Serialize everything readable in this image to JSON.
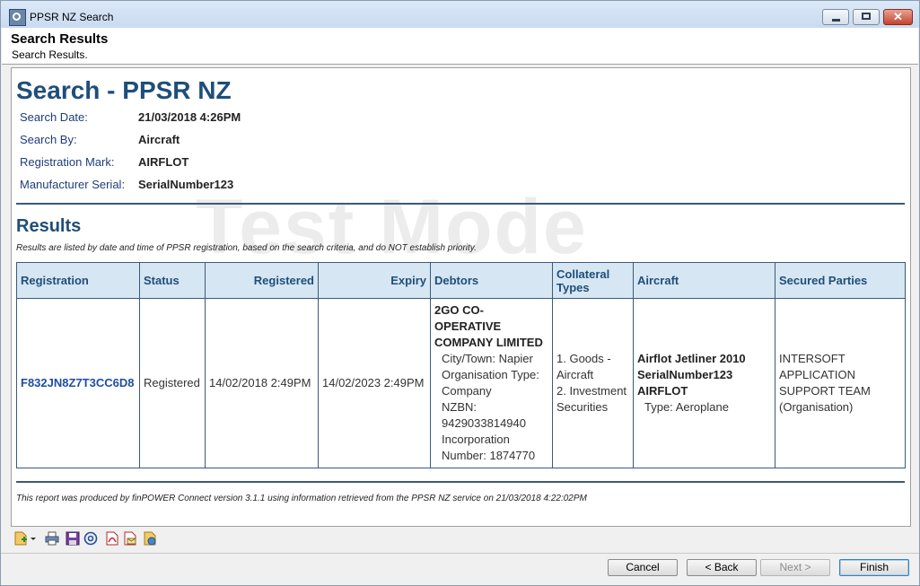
{
  "window": {
    "title": "PPSR NZ Search"
  },
  "header": {
    "title": "Search Results",
    "subtitle": "Search Results."
  },
  "report": {
    "title": "Search - PPSR NZ",
    "watermark": "Test Mode",
    "fields": [
      {
        "label": "Search Date:",
        "value": "21/03/2018 4:26PM"
      },
      {
        "label": "Search By:",
        "value": "Aircraft"
      },
      {
        "label": "Registration Mark:",
        "value": "AIRFLOT"
      },
      {
        "label": "Manufacturer Serial:",
        "value": "SerialNumber123"
      }
    ],
    "results_title": "Results",
    "results_note": "Results are listed by date and time of PPSR registration, based on the search criteria, and do NOT establish priority.",
    "columns": [
      "Registration",
      "Status",
      "Registered",
      "Expiry",
      "Debtors",
      "Collateral Types",
      "Aircraft",
      "Secured Parties"
    ],
    "row": {
      "registration": "F832JN8Z7T3CC6D8",
      "status": "Registered",
      "registered": "14/02/2018 2:49PM",
      "expiry": "14/02/2023 2:49PM",
      "debtor_name": "2GO CO-OPERATIVE COMPANY LIMITED",
      "debtor_city": "City/Town: Napier",
      "debtor_org_type": "Organisation Type: Company",
      "debtor_nzbn": "NZBN: 9429033814940",
      "debtor_incorporation": "Incorporation Number: 1874770",
      "collateral_1": "1. Goods - Aircraft",
      "collateral_2": "2. Investment Securities",
      "aircraft_model": "Airflot Jetliner 2010",
      "aircraft_serial": "SerialNumber123",
      "aircraft_mark": "AIRFLOT",
      "aircraft_type": "Type: Aeroplane",
      "secured_party": "INTERSOFT APPLICATION SUPPORT TEAM (Organisation)"
    },
    "footer_note": "This report was produced by finPOWER Connect version 3.1.1 using information retrieved from the PPSR NZ service on 21/03/2018 4:22:02PM"
  },
  "toolbar": {
    "icons": [
      "new-document-icon",
      "dropdown-arrow-icon",
      "print-icon",
      "save-icon",
      "email-icon",
      "pdf-icon",
      "pdf-email-icon",
      "web-export-icon"
    ]
  },
  "buttons": {
    "cancel": "Cancel",
    "back": "< Back",
    "next": "Next >",
    "finish": "Finish"
  }
}
